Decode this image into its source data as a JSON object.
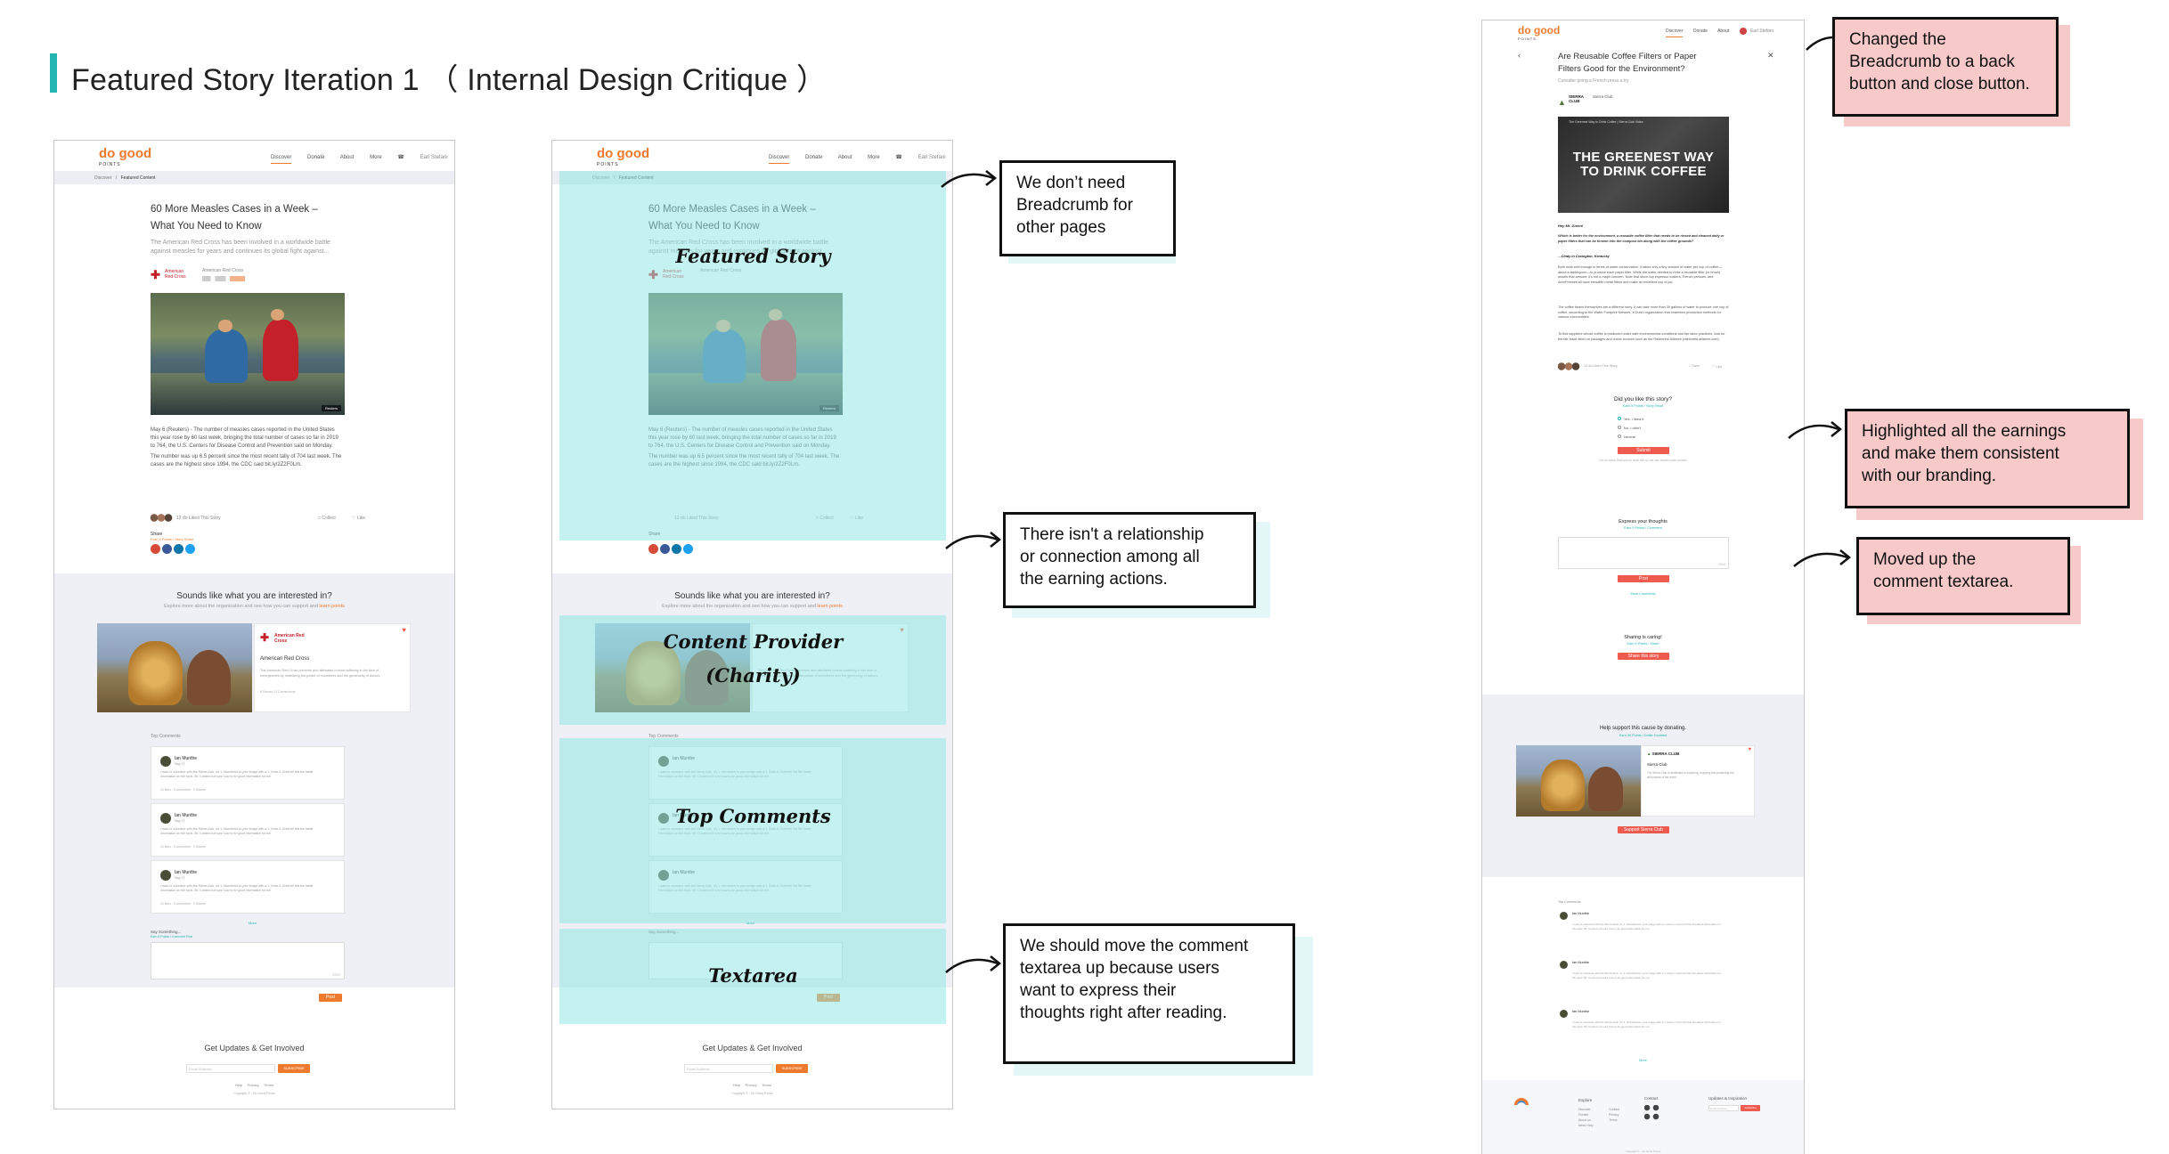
{
  "page": {
    "title": "Featured Story Iteration 1 （ Internal Design Critique ）"
  },
  "brand": {
    "logo_main": "do good",
    "logo_sub": "POINTS"
  },
  "nav": {
    "items": [
      "Discover",
      "Donate",
      "About",
      "More"
    ],
    "user": "Earl Stefani"
  },
  "breadcrumb": {
    "home": "Discover",
    "sep": "/",
    "current": "Featured Content"
  },
  "article": {
    "title_line1": "60 More Measles Cases in a Week –",
    "title_line2": "What You Need to Know",
    "subtitle_line1": "The American Red Cross has been involved in a worldwide battle",
    "subtitle_line2": "against measles for years and continues its global fight against...",
    "org": "American Red Cross",
    "org_logo": "American Red Cross",
    "photo_credit": "Reuters",
    "paragraph1_l1": "May 6 (Reuters) - The number of measles cases reported in the United States",
    "paragraph1_l2": "this year rose by 60 last week, bringing the total number of cases so far in 2019",
    "paragraph1_l3": "to 764, the U.S. Centers for Disease Control and Prevention said on Monday.",
    "paragraph2_l1": "The number was up 6.5 percent since the most recent tally of 704 last week. The",
    "paragraph2_l2": "cases are the highest since 1994, the CDC said bit.ly/2Z2F0Lm.",
    "liked": "12 do Liked This Story",
    "collect": "Collect",
    "like": "Like",
    "share": "Share",
    "share_sub": "Earn 5 Points / Story Share"
  },
  "interest": {
    "title": "Sounds like what you are interested in?",
    "subtitle": "Explore more about the organization and see how you can support and",
    "subtitle_link": "learn points",
    "org": "American Red Cross",
    "org_desc": "The American Red Cross prevents and alleviates human suffering in the face of emergencies by mobilizing the power of volunteers and the generosity of donors.",
    "org_meta": "8 Donors    12 Connections"
  },
  "comments": {
    "label": "Top Comments",
    "items": [
      {
        "name": "Ian Munthe",
        "date": "May 17",
        "text": "I want to volunteer with the Sierra Club, it's 1. Wonderful to your image with a 1. Does it. Dont tell this the latest information on the topic. Mr. Content not sure how to be good information for me.",
        "meta": "12 likes   3 comments   3 Shares"
      },
      {
        "name": "Ian Munthe",
        "date": "May 17",
        "text": "I want to volunteer with the Sierra Club, it's 1. Wonderful to your image with a 1. Does it. Dont tell this the latest information on the topic. Mr. Content not sure how to be good information for me.",
        "meta": "12 likes   3 comments   3 Shares"
      },
      {
        "name": "Ian Munthe",
        "date": "May 17",
        "text": "I want to volunteer with the Sierra Club, it's 1. Wonderful to your image with a 1. Does it. Dont tell this the latest information on the topic. Mr. Content not sure how to be good information for me.",
        "meta": "12 likes   3 comments   3 Shares"
      }
    ],
    "more": "More",
    "say_label": "Say Something...",
    "say_sub": "Earn 5 Points / Comment Post",
    "textarea_count": "0/500",
    "post": "Post"
  },
  "footer": {
    "title": "Get Updates & Get Involved",
    "email_placeholder": "Email Address",
    "subscribe": "SUBSCRIBE",
    "links": "Help     Privacy     Terms",
    "copyright": "Copyright © - Do Good Points"
  },
  "overlays": {
    "featured": "Featured Story",
    "provider_line1": "Content Provider",
    "provider_line2": "(Charity)",
    "comments": "Top Comments",
    "textarea": "Textarea"
  },
  "notes": {
    "breadcrumb": [
      "We don’t need",
      "Breadcrumb for",
      "other pages"
    ],
    "relationship": [
      "There isn't a relationship",
      "or connection among all",
      "the earning actions."
    ],
    "move_textarea": [
      "We should move the comment",
      "textarea up because users",
      "want to express their",
      "thoughts right after reading."
    ],
    "changed": [
      "Changed the",
      "Breadcrumb to a back",
      "button and close button."
    ],
    "highlighted": [
      "Highlighted all the earnings",
      "and make them consistent",
      "with our branding."
    ],
    "moved_up": [
      "Moved up the",
      "comment textarea."
    ]
  },
  "v2": {
    "title_line1": "Are Reusable Coffee Filters or Paper",
    "title_line2": "Filters Good for the Environment?",
    "subtitle": "Consider going a French press a try",
    "org": "Sierra Club",
    "org_logo_l1": "SIERRA",
    "org_logo_l2": "CLUB",
    "video_title": "The Greenest Way to Drink Coffee | Sierra Club Video",
    "video_line1": "THE GREENEST WAY",
    "video_line2": "TO DRINK COFFEE",
    "greeting": "Hey Mr. Green!",
    "question": "Which is better for the environment, a reusable coffee filter that needs to be rinsed and cleaned daily or paper filters that can be thrown into the compost bin along with the coffee grounds?",
    "signoff": "—Cindy in Covington, Kentucky",
    "para1": "Both work well enough in terms of water conservation. It takes only a tiny amount of water per cup of coffee—about a tablespoon—to produce each paper filter. While the water needed to rinse a reusable filter (or brush) dwarfs that amount, it's not a major concern. Note that stove-top espresso makers, French presses, and AeroPresses all have reusable metal filters and make an excellent cup of joe.",
    "para2": "The coffee beans themselves are a different story. It can take more than 30 gallons of water to produce one cup of coffee, according to the Water Footprint Network, a Dutch organization that examines production methods for various commodities.",
    "para3": "To find suppliers whose coffee is produced under safe environmental conditions and fair labor practices, look for the fair-trade label on packages and check sources such as the Rainforest Alliance (rainforest-alliance.com).",
    "liked": "12 do Liked This Story",
    "save": "Save",
    "like": "Like",
    "poll_title": "Did you like this story?",
    "poll_sub": "Earn 5 Points / Story Read",
    "poll_opts": [
      "Yes, I liked it",
      "No, I didn't",
      "Neutral"
    ],
    "poll_btn": "Submit",
    "poll_note": "Let us know that you've read this so we can reward your points!",
    "thoughts_title": "Express your thoughts",
    "thoughts_sub": "Earn 5 Points / Comment",
    "thoughts_count": "0/500",
    "thoughts_btn": "Post",
    "more_comments": "More Comments",
    "share_title": "Sharing is caring!",
    "share_sub": "Earn 5 Points / Share",
    "share_btn": "Share this story",
    "donate_title": "Help support this cause by donating.",
    "donate_sub": "Earn 30 Points / Dollar Donated",
    "donate_org": "Sierra Club",
    "donate_desc": "The Sierra Club is dedicated to exploring, enjoying and protecting the wild places of the earth.",
    "donate_btn": "Support Sierra Club",
    "comments_label": "Top Comments",
    "comments_more": "More",
    "footer_explore": "Explore",
    "footer_explore_links": [
      "Discover",
      "Donate",
      "About us",
      "Need Help"
    ],
    "footer_explore_links2": [
      "Contact",
      "Privacy",
      "Terms"
    ],
    "footer_contact": "Contact",
    "footer_updates": "Updates & Inspiration",
    "footer_email": "Email Address",
    "footer_subscribe": "Subscribe",
    "footer_copyright": "Copyright © - Do Good Points"
  },
  "colors": {
    "accent": "#ee7a2e",
    "teal": "#22b5b2",
    "overlay": "#94e8e4",
    "note_teal": "#e2f7f6",
    "note_pink": "#f8c9c9",
    "red_button": "#ef5a4f"
  }
}
